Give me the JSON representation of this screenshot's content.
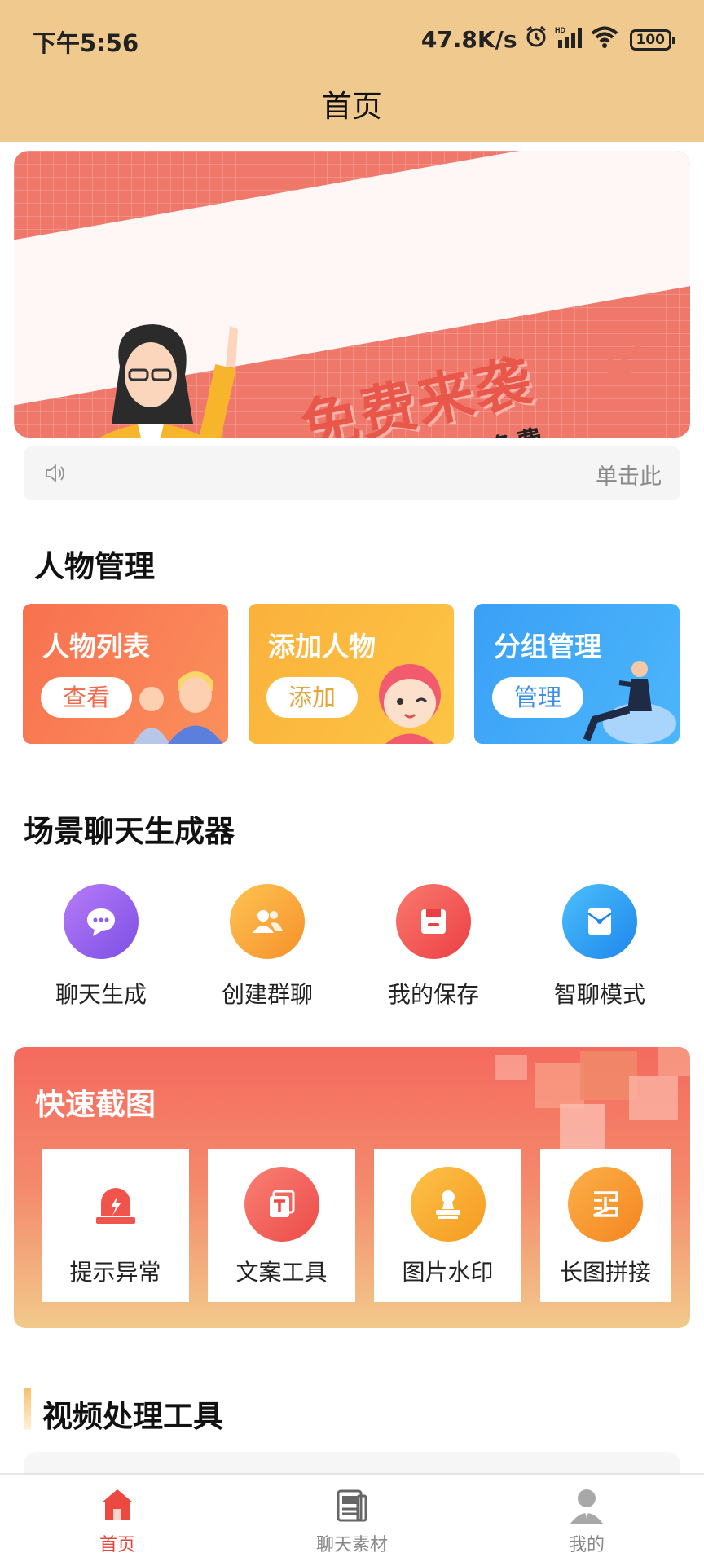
{
  "status": {
    "time": "下午5:56",
    "speed": "47.8K/s",
    "battery": "100"
  },
  "header": {
    "title": "首页"
  },
  "banner": {
    "headline": "免费来袭",
    "subline": "所有功能限时免费"
  },
  "notice": {
    "text": "单击此"
  },
  "person_section": {
    "title": "人物管理",
    "cards": [
      {
        "title": "人物列表",
        "button": "查看"
      },
      {
        "title": "添加人物",
        "button": "添加"
      },
      {
        "title": "分组管理",
        "button": "管理"
      }
    ]
  },
  "scene_section": {
    "title": "场景聊天生成器",
    "items": [
      {
        "label": "聊天生成",
        "icon": "chat-bubble-icon",
        "color": "#8d5cf0"
      },
      {
        "label": "创建群聊",
        "icon": "group-icon",
        "color": "#fba43c"
      },
      {
        "label": "我的保存",
        "icon": "save-icon",
        "color": "#f0554f"
      },
      {
        "label": "智聊模式",
        "icon": "envelope-icon",
        "color": "#2d9af2"
      }
    ]
  },
  "quick_section": {
    "title": "快速截图",
    "items": [
      {
        "label": "提示异常",
        "icon": "alarm-light-icon",
        "color": "#f0544c"
      },
      {
        "label": "文案工具",
        "icon": "text-tool-icon",
        "color": "#f0544c"
      },
      {
        "label": "图片水印",
        "icon": "stamp-icon",
        "color": "#f7a52b"
      },
      {
        "label": "长图拼接",
        "icon": "stitch-icon",
        "color": "#f7902b"
      }
    ]
  },
  "video_section": {
    "title": "视频处理工具"
  },
  "bottom_nav": [
    {
      "label": "首页",
      "icon": "home-icon",
      "active": true
    },
    {
      "label": "聊天素材",
      "icon": "material-icon",
      "active": false
    },
    {
      "label": "我的",
      "icon": "user-icon",
      "active": false
    }
  ],
  "colors": {
    "header_bg": "#efc98e",
    "accent": "#e8433a"
  }
}
